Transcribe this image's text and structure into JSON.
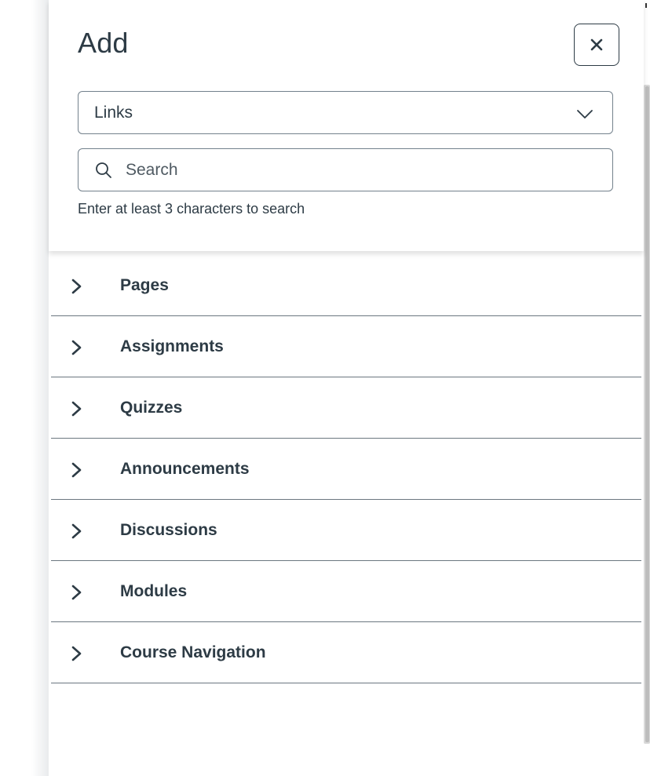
{
  "tray": {
    "title": "Add",
    "close_icon": "close-icon",
    "filter_select": {
      "selected": "Links",
      "icon": "chevron-down-icon"
    },
    "search": {
      "placeholder": "Search",
      "value": "",
      "icon": "search-icon"
    },
    "hint": "Enter at least 3 characters to search"
  },
  "sections": [
    {
      "label": "Pages",
      "icon": "chevron-right-icon"
    },
    {
      "label": "Assignments",
      "icon": "chevron-right-icon"
    },
    {
      "label": "Quizzes",
      "icon": "chevron-right-icon"
    },
    {
      "label": "Announcements",
      "icon": "chevron-right-icon"
    },
    {
      "label": "Discussions",
      "icon": "chevron-right-icon"
    },
    {
      "label": "Modules",
      "icon": "chevron-right-icon"
    },
    {
      "label": "Course Navigation",
      "icon": "chevron-right-icon"
    }
  ],
  "colors": {
    "text": "#2d3b45",
    "border": "#73818c",
    "divider": "#6b7780",
    "background": "#ffffff"
  }
}
